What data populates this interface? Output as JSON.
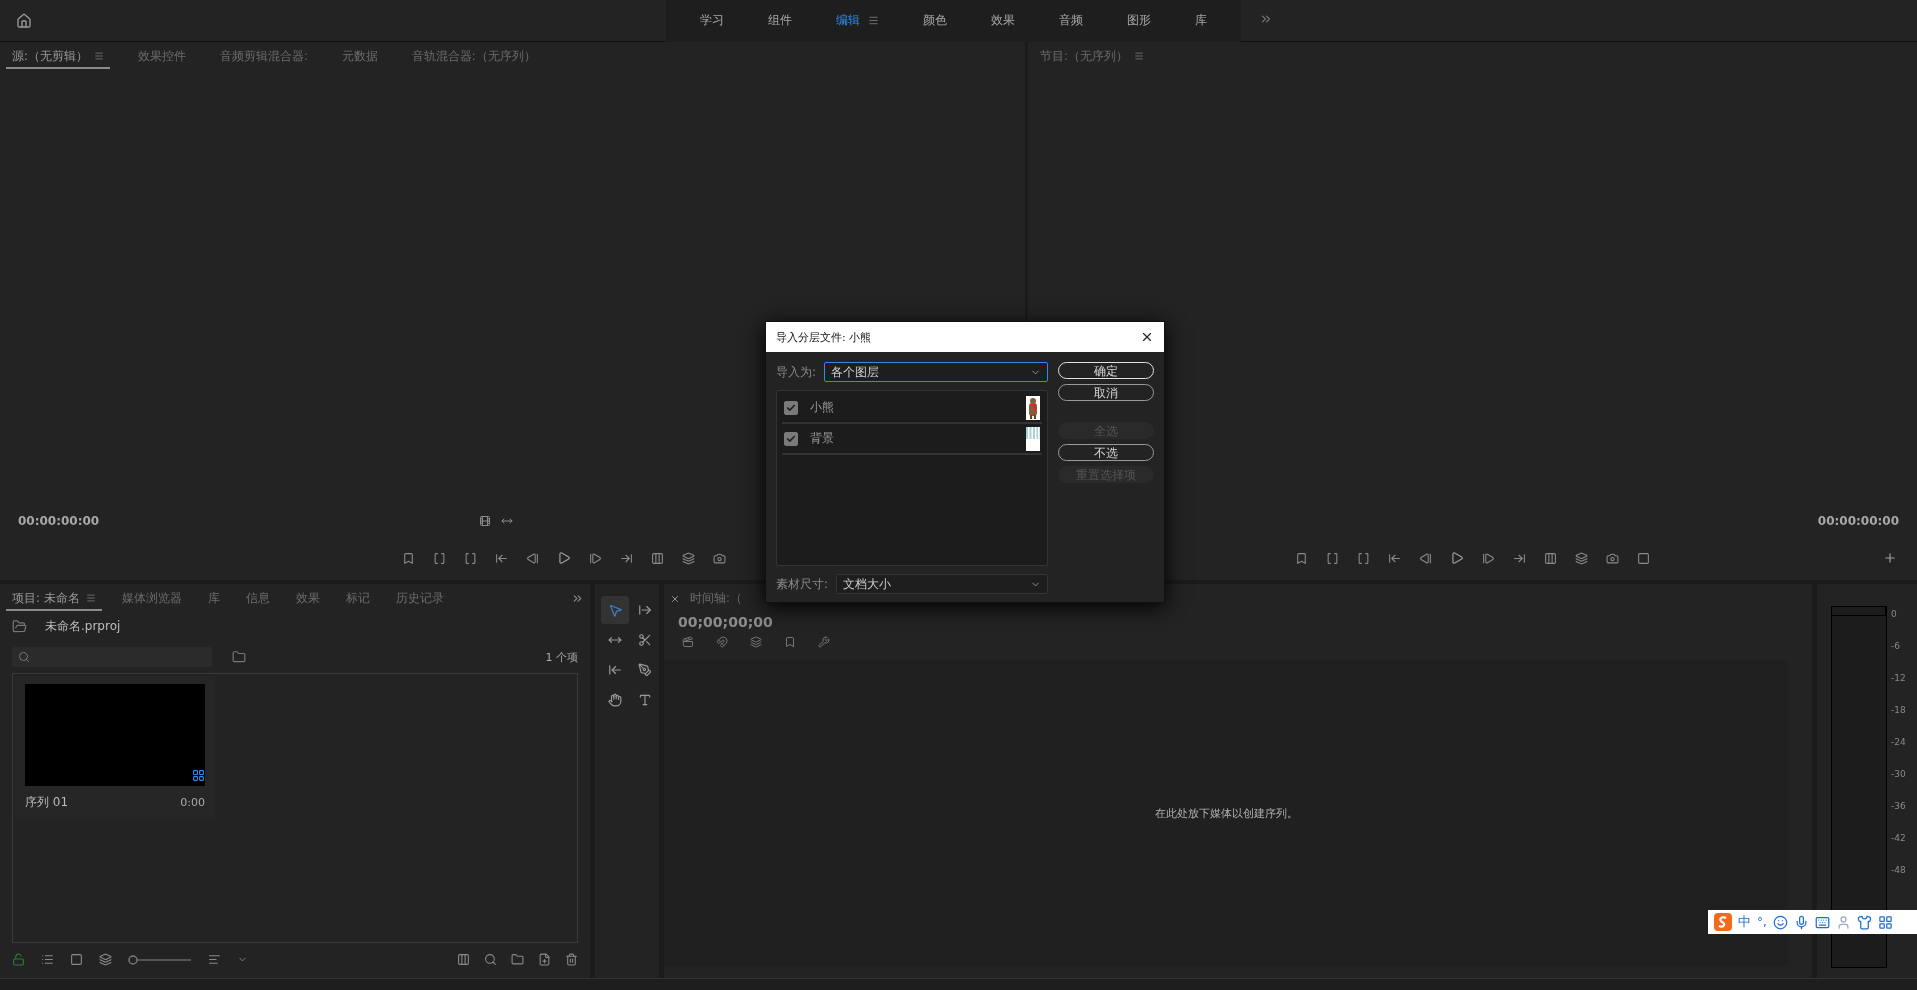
{
  "top_bar": {
    "workspaces": [
      {
        "label": "学习",
        "selected": false
      },
      {
        "label": "组件",
        "selected": false
      },
      {
        "label": "编辑",
        "selected": true
      },
      {
        "label": "颜色",
        "selected": false
      },
      {
        "label": "效果",
        "selected": false
      },
      {
        "label": "音频",
        "selected": false
      },
      {
        "label": "图形",
        "selected": false
      },
      {
        "label": "库",
        "selected": false
      }
    ]
  },
  "source_panel": {
    "tabs": [
      {
        "label": "源:（无剪辑）",
        "selected": true
      },
      {
        "label": "效果控件",
        "selected": false
      },
      {
        "label": "音频剪辑混合器:",
        "selected": false
      },
      {
        "label": "元数据",
        "selected": false
      },
      {
        "label": "音轨混合器:（无序列）",
        "selected": false
      }
    ],
    "timecode": "00:00:00:00"
  },
  "program_panel": {
    "title": "节目:（无序列）",
    "timecode": "00:00:00:00"
  },
  "project_panel": {
    "tabs": [
      {
        "label": "项目: 未命名",
        "selected": true
      },
      {
        "label": "媒体浏览器",
        "selected": false
      },
      {
        "label": "库",
        "selected": false
      },
      {
        "label": "信息",
        "selected": false
      },
      {
        "label": "效果",
        "selected": false
      },
      {
        "label": "标记",
        "selected": false
      },
      {
        "label": "历史记录",
        "selected": false
      }
    ],
    "file": "未命名.prproj",
    "item_count": "1 个项",
    "zoom_slider": {
      "level": 0
    },
    "items": [
      {
        "name": "序列 01",
        "duration": "0:00"
      }
    ]
  },
  "timeline": {
    "tab": "时间轴:（",
    "timecode": "00;00;00;00",
    "empty_message": "在此处放下媒体以创建序列。"
  },
  "meter": {
    "scale": [
      "0",
      "-6",
      "-12",
      "-18",
      "-24",
      "-30",
      "-36",
      "-42",
      "-48"
    ]
  },
  "dialog": {
    "title": "导入分层文件: 小熊",
    "import_as_label": "导入为:",
    "import_as": "各个图层",
    "layers": [
      {
        "name": "小熊",
        "checked": true,
        "kind": "figure"
      },
      {
        "name": "背景",
        "checked": true,
        "kind": "stripes"
      }
    ],
    "size_label": "素材尺寸:",
    "size": "文档大小",
    "buttons": [
      {
        "label": "确定",
        "disabled": false,
        "default": true
      },
      {
        "label": "取消",
        "disabled": false,
        "default": false
      },
      {
        "label": "全选",
        "disabled": true,
        "default": false
      },
      {
        "label": "不选",
        "disabled": false,
        "default": false
      },
      {
        "label": "重置选择项",
        "disabled": true,
        "default": false
      }
    ]
  },
  "ime_bar": {
    "mode": "中",
    "punct": "°,"
  }
}
